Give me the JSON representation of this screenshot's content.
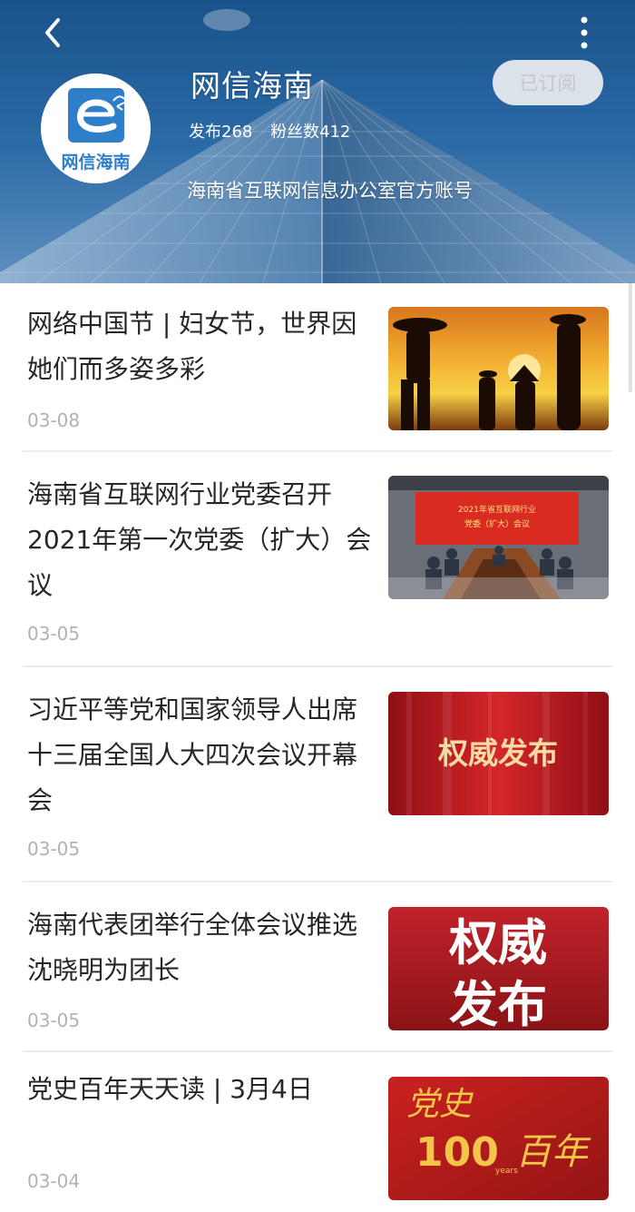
{
  "header": {
    "account_name": "网信海南",
    "publish_count": "发布268",
    "fans_count": "粉丝数412",
    "description": "海南省互联网信息办公室官方账号",
    "subscribe_label": "已订阅",
    "logo_text": "网信海南"
  },
  "icons": {
    "back": "chevron-left-icon",
    "more": "vertical-dots-icon"
  },
  "articles": [
    {
      "title": "网络中国节 | 妇女节，世界因她们而多姿多彩",
      "date": "03-08"
    },
    {
      "title": "海南省互联网行业党委召开2021年第一次党委（扩大）会议",
      "date": "03-05",
      "thumb_text_1": "2021年省互联网行业",
      "thumb_text_2": "党委（扩大）会议"
    },
    {
      "title": "习近平等党和国家领导人出席十三届全国人大四次会议开幕会",
      "date": "03-05",
      "thumb_text": "权威发布"
    },
    {
      "title": "海南代表团举行全体会议推选沈晓明为团长",
      "date": "03-05",
      "thumb_text_1": "权威",
      "thumb_text_2": "发布"
    },
    {
      "title": "党史百年天天读 | 3月4日",
      "date": "03-04",
      "thumb_text_1": "党史",
      "thumb_text_2": "100",
      "thumb_text_3": "百年",
      "thumb_text_4": "years"
    }
  ],
  "colors": {
    "header_blue": "#2a6fb0",
    "title_text": "#262626",
    "date_text": "#b2b2b2",
    "subscribe_bg": "#eceef0",
    "thumb_red": "#b51f24"
  }
}
